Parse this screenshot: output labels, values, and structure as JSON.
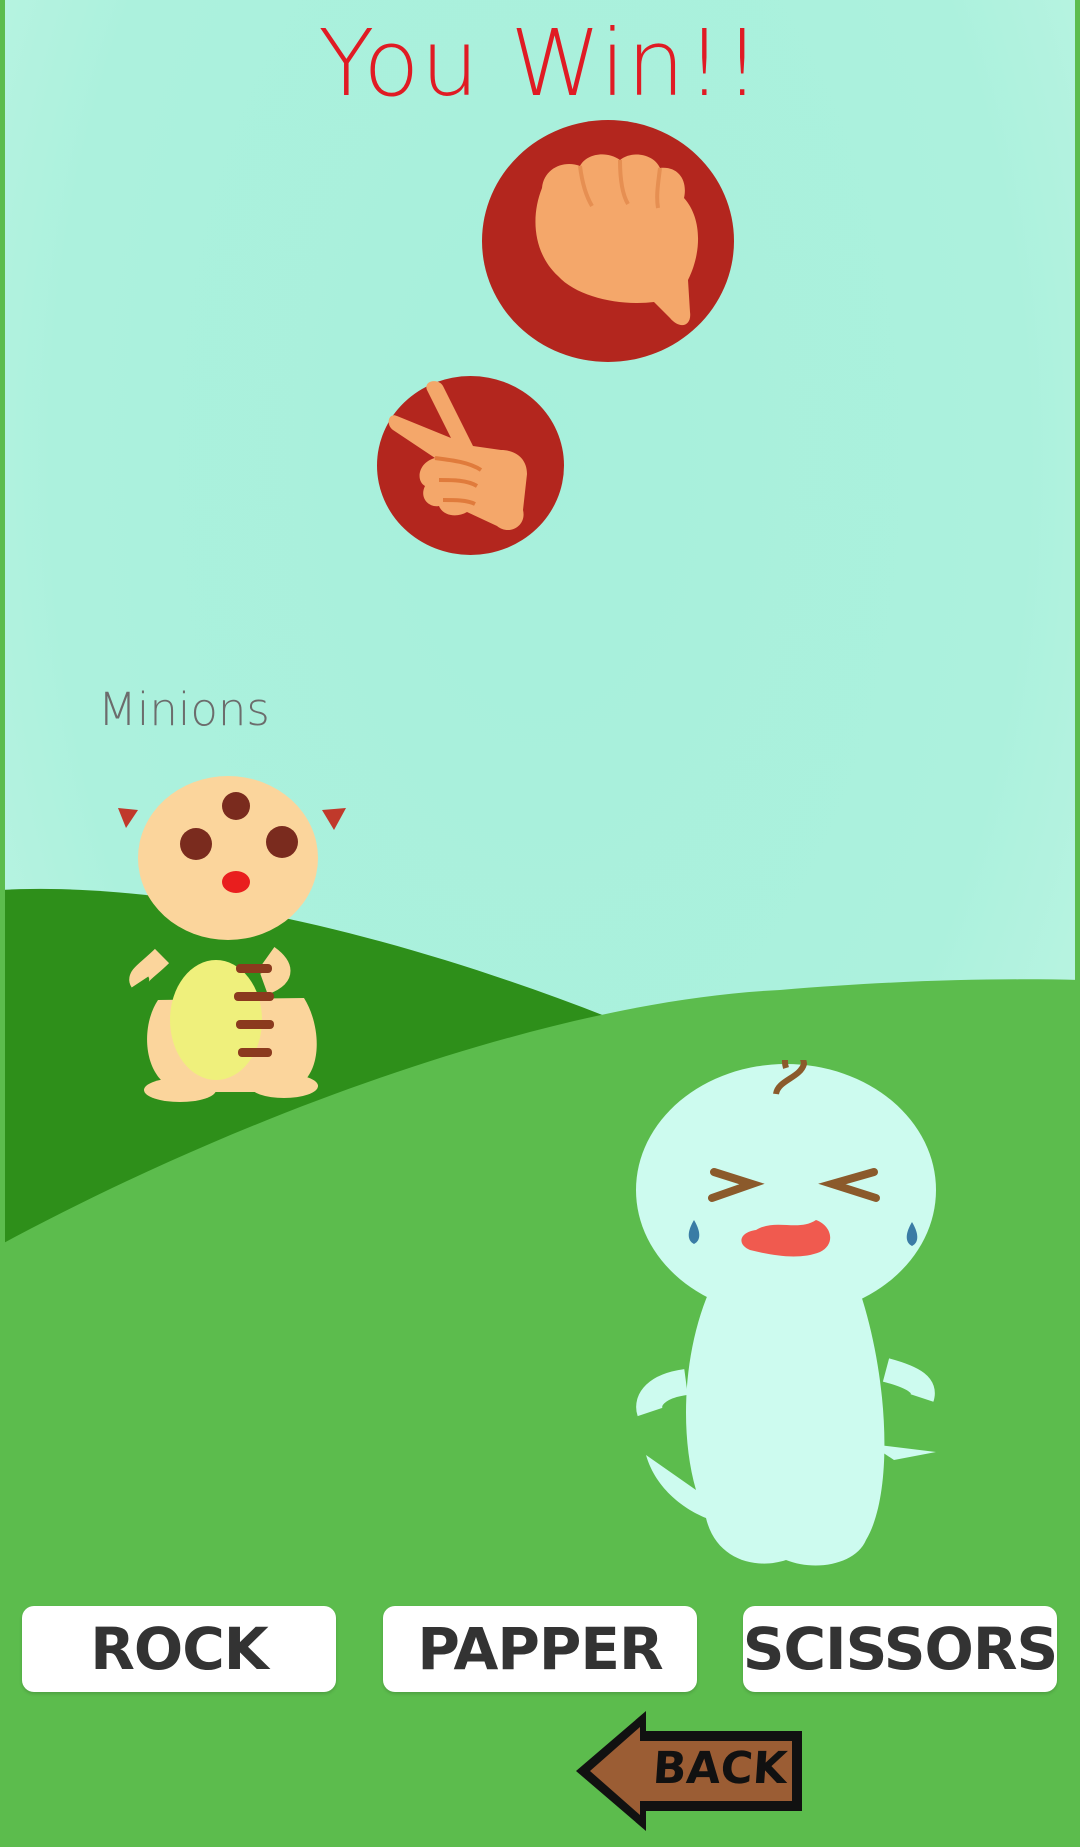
{
  "game": {
    "result_text": "You Win!!",
    "player_choice_icon": "rock-hand-icon",
    "opponent_choice_icon": "scissors-hand-icon",
    "opponent_name": "Minions"
  },
  "controls": {
    "rock_label": "ROCK",
    "paper_label": "PAPPER",
    "scissors_label": "SCISSORS",
    "back_label": "BACK"
  },
  "colors": {
    "sky": "#aef2dc",
    "hill_dark": "#2e8f1a",
    "hill_light": "#5cbc4d",
    "choice_circle": "#b3261e",
    "result_text": "#e01b24",
    "back_arrow": "#9b5d34"
  }
}
